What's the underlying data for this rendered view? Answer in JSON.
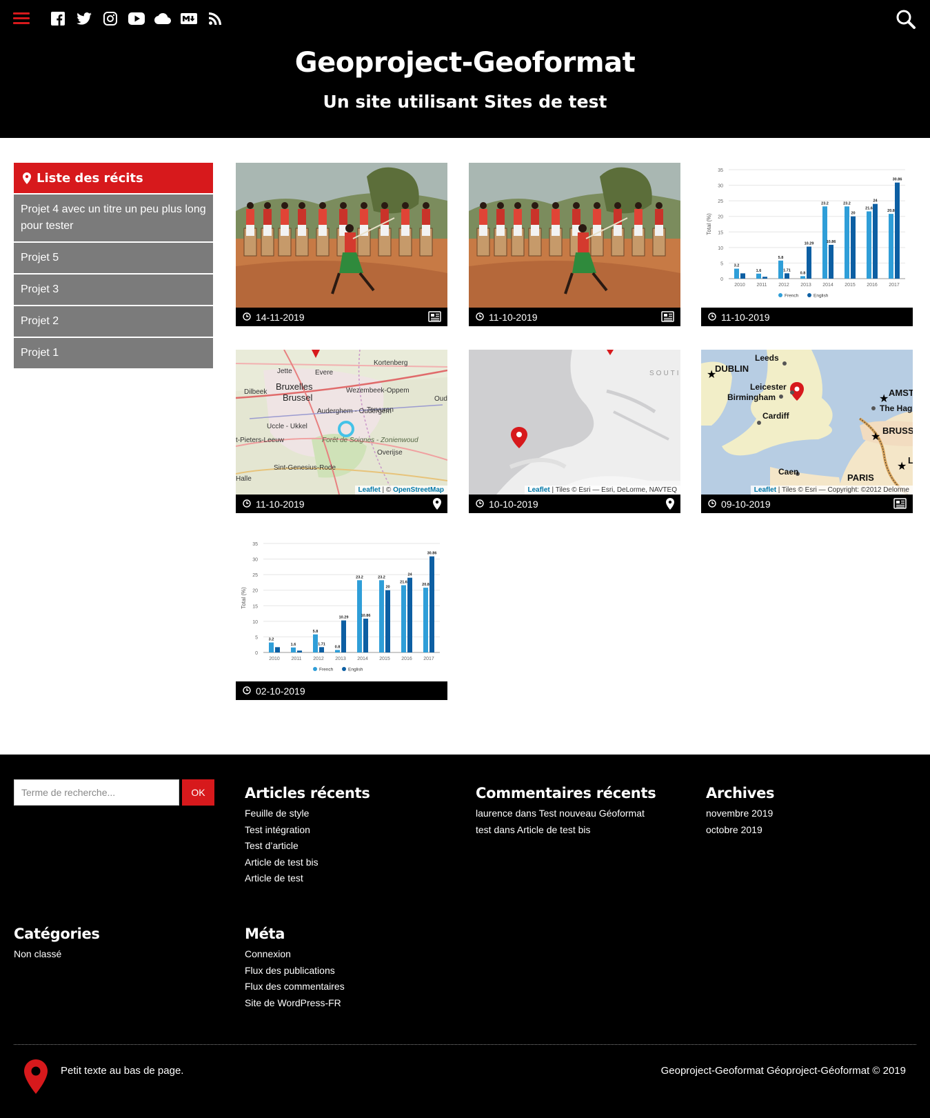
{
  "header": {
    "site_title": "Geoproject-Geoformat",
    "site_subtitle": "Un site utilisant Sites de test",
    "menu_icon": "hamburger-menu-icon",
    "search_icon": "search-icon",
    "social_icons": [
      "facebook-icon",
      "twitter-icon",
      "instagram-icon",
      "youtube-icon",
      "cloud-icon",
      "markdown-icon",
      "rss-icon"
    ],
    "accent_color": "#d7191c"
  },
  "sidebar": {
    "title": "Liste des récits",
    "items": [
      {
        "label": "Projet 4 avec un titre un peu plus long pour tester"
      },
      {
        "label": "Projet 5"
      },
      {
        "label": "Projet 3"
      },
      {
        "label": "Projet 2"
      },
      {
        "label": "Projet 1"
      }
    ]
  },
  "cards": [
    {
      "date": "14-11-2019",
      "thumb": "drummers-photo",
      "type_icon": "newspaper-icon"
    },
    {
      "date": "11-10-2019",
      "thumb": "drummers-photo",
      "type_icon": "newspaper-icon"
    },
    {
      "date": "11-10-2019",
      "thumb": "bar-chart",
      "type_icon": ""
    },
    {
      "date": "11-10-2019",
      "thumb": "map-brussels",
      "type_icon": "map-pin-icon",
      "map_labels": [
        "Kortenberg",
        "Jette",
        "Evere",
        "Bruxelles",
        "Brussel",
        "Dilbeek",
        "Wezembeek-Oppem",
        "Oud",
        "Auderghem - Oudergem",
        "Tervuren",
        "Uccle - Ukkel",
        "t-Pieters-Leeuw",
        "Forêt de Soignes - Zonienwoud",
        "Overijse",
        "Sint-Genesius-Rode",
        "Halle"
      ],
      "attribution_link": "Leaflet",
      "attribution_text": " | © ",
      "attribution_link2": "OpenStreetMap"
    },
    {
      "date": "10-10-2019",
      "thumb": "map-coast",
      "type_icon": "map-pin-icon",
      "map_labels": [
        "SOUTI"
      ],
      "attribution_link": "Leaflet",
      "attribution_text": " | Tiles © Esri — Esri, DeLorme, NAVTEQ"
    },
    {
      "date": "09-10-2019",
      "thumb": "map-uk",
      "type_icon": "newspaper-icon",
      "map_labels": [
        "Leeds",
        "DUBLIN",
        "Leicester",
        "Birmingham",
        "AMST",
        "The Hagu",
        "Cardiff",
        "BRUSS",
        "Caen",
        "PARIS",
        "L"
      ],
      "attribution_link": "Leaflet",
      "attribution_text": " | Tiles © Esri — Copyright: ©2012 Delorme"
    },
    {
      "date": "02-10-2019",
      "thumb": "bar-chart",
      "type_icon": ""
    }
  ],
  "chart_data": {
    "type": "bar",
    "categories": [
      "2010",
      "2011",
      "2012",
      "2013",
      "2014",
      "2015",
      "2016",
      "2017"
    ],
    "series": [
      {
        "name": "French",
        "values": [
          3.2,
          1.6,
          5.8,
          0.8,
          23.2,
          23.2,
          21.6,
          20.8
        ],
        "color": "#2f9ed8"
      },
      {
        "name": "English",
        "values": [
          1.7,
          0.6,
          1.71,
          10.29,
          10.86,
          20,
          24,
          30.86
        ],
        "color": "#0d5fa3"
      }
    ],
    "value_labels": {
      "French": [
        "3.2",
        "1.6",
        "5.8",
        "0.8",
        "23.2",
        "23.2",
        "21.6",
        "20.8"
      ],
      "English": [
        "",
        "",
        "1.71",
        "10.29",
        "10.86",
        "20",
        "24",
        "30.86"
      ]
    },
    "ylabel": "Total (%)",
    "ylim": [
      0,
      35
    ],
    "yticks": [
      0,
      5,
      10,
      15,
      20,
      25,
      30,
      35
    ],
    "grid": true,
    "legend": "bottom"
  },
  "footer": {
    "search_placeholder": "Terme de recherche...",
    "search_button": "OK",
    "recent_articles": {
      "title": "Articles récents",
      "items": [
        "Feuille de style",
        "Test intégration",
        "Test d’article",
        "Article de test bis",
        "Article de test"
      ]
    },
    "recent_comments": {
      "title": "Commentaires récents",
      "items": [
        "laurence dans Test nouveau Géoformat",
        "test dans Article de test bis"
      ]
    },
    "archives": {
      "title": "Archives",
      "items": [
        "novembre 2019",
        "octobre 2019"
      ]
    },
    "categories": {
      "title": "Catégories",
      "items": [
        "Non classé"
      ]
    },
    "meta": {
      "title": "Méta",
      "items": [
        "Connexion",
        "Flux des publications",
        "Flux des commentaires",
        "Site de WordPress-FR"
      ]
    },
    "bottom_text": "Petit texte au bas de page.",
    "copyright": "Geoproject-Geoformat Géoproject-Géoformat © 2019"
  }
}
